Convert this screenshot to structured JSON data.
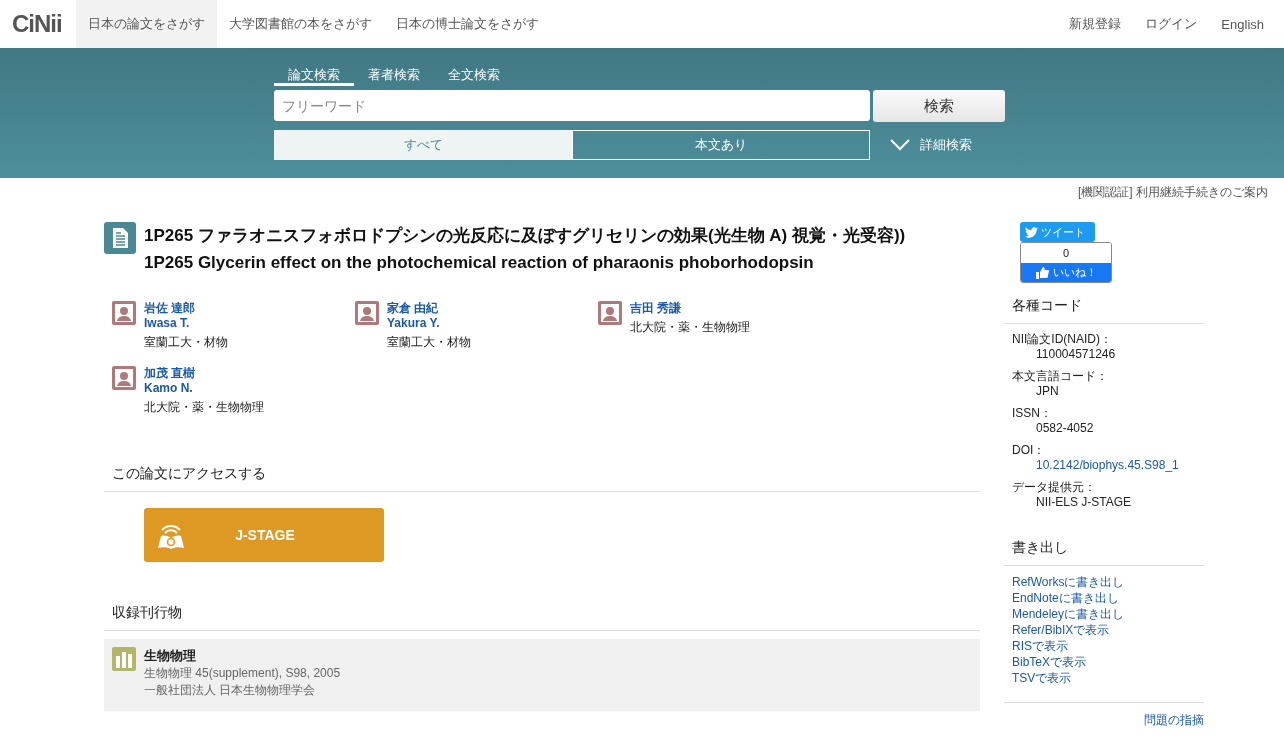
{
  "nav": {
    "logo": "CiNii",
    "items": [
      {
        "label": "日本の論文をさがす",
        "selected": true
      },
      {
        "label": "大学図書館の本をさがす",
        "selected": false
      },
      {
        "label": "日本の博士論文をさがす",
        "selected": false
      }
    ],
    "right": [
      "新規登録",
      "ログイン",
      "English"
    ]
  },
  "search": {
    "tabs": [
      {
        "label": "論文検索",
        "selected": true
      },
      {
        "label": "著者検索",
        "selected": false
      },
      {
        "label": "全文検索",
        "selected": false
      }
    ],
    "placeholder": "フリーワード",
    "button": "検索",
    "filters": [
      {
        "label": "すべて",
        "selected": true
      },
      {
        "label": "本文あり",
        "selected": false
      }
    ],
    "advanced": "詳細検索"
  },
  "notice": "[機関認証] 利用継続手続きのご案内",
  "article": {
    "title_ja": "1P265 ファラオニスフォボロドプシンの光反応に及ぼすグリセリンの効果(光生物 A) 視覚・光受容))",
    "title_en": "1P265 Glycerin effect on the photochemical reaction of pharaonis phoborhodopsin",
    "authors": [
      {
        "name_ja": "岩佐 達郎",
        "name_en": "Iwasa T.",
        "affiliation": "室蘭工大・材物"
      },
      {
        "name_ja": "家倉 由紀",
        "name_en": "Yakura Y.",
        "affiliation": "室蘭工大・材物"
      },
      {
        "name_ja": "吉田 秀謙",
        "affiliation": "北大院・薬・生物物理"
      },
      {
        "name_ja": "加茂 直樹",
        "name_en": "Kamo N.",
        "affiliation": "北大院・薬・生物物理"
      }
    ]
  },
  "access": {
    "heading": "この論文にアクセスする",
    "button": "J-STAGE"
  },
  "journal": {
    "heading": "収録刊行物",
    "title": "生物物理",
    "details": "生物物理 45(supplement), S98, 2005",
    "publisher": "一般社団法人 日本生物物理学会"
  },
  "social": {
    "tweet": "ツイート",
    "like_count": "0",
    "like": "いいね！"
  },
  "codes": {
    "heading": "各種コード",
    "items": [
      {
        "label": "NII論文ID(NAID)：",
        "value": "110004571246",
        "kind": "text"
      },
      {
        "label": "本文言語コード：",
        "value": "JPN",
        "kind": "text"
      },
      {
        "label": "ISSN：",
        "value": "0582-4052",
        "kind": "text"
      },
      {
        "label": "DOI：",
        "value": "10.2142/biophys.45.S98_1",
        "kind": "link"
      },
      {
        "label": "データ提供元：",
        "value": "NII-ELS  J-STAGE",
        "kind": "text"
      }
    ]
  },
  "export": {
    "heading": "書き出し",
    "links": [
      "RefWorksに書き出し",
      "EndNoteに書き出し",
      "Mendeleyに書き出し",
      "Refer/BibIXで表示",
      "RISで表示",
      "BibTeXで表示",
      "TSVで表示"
    ]
  },
  "report": "問題の指摘"
}
